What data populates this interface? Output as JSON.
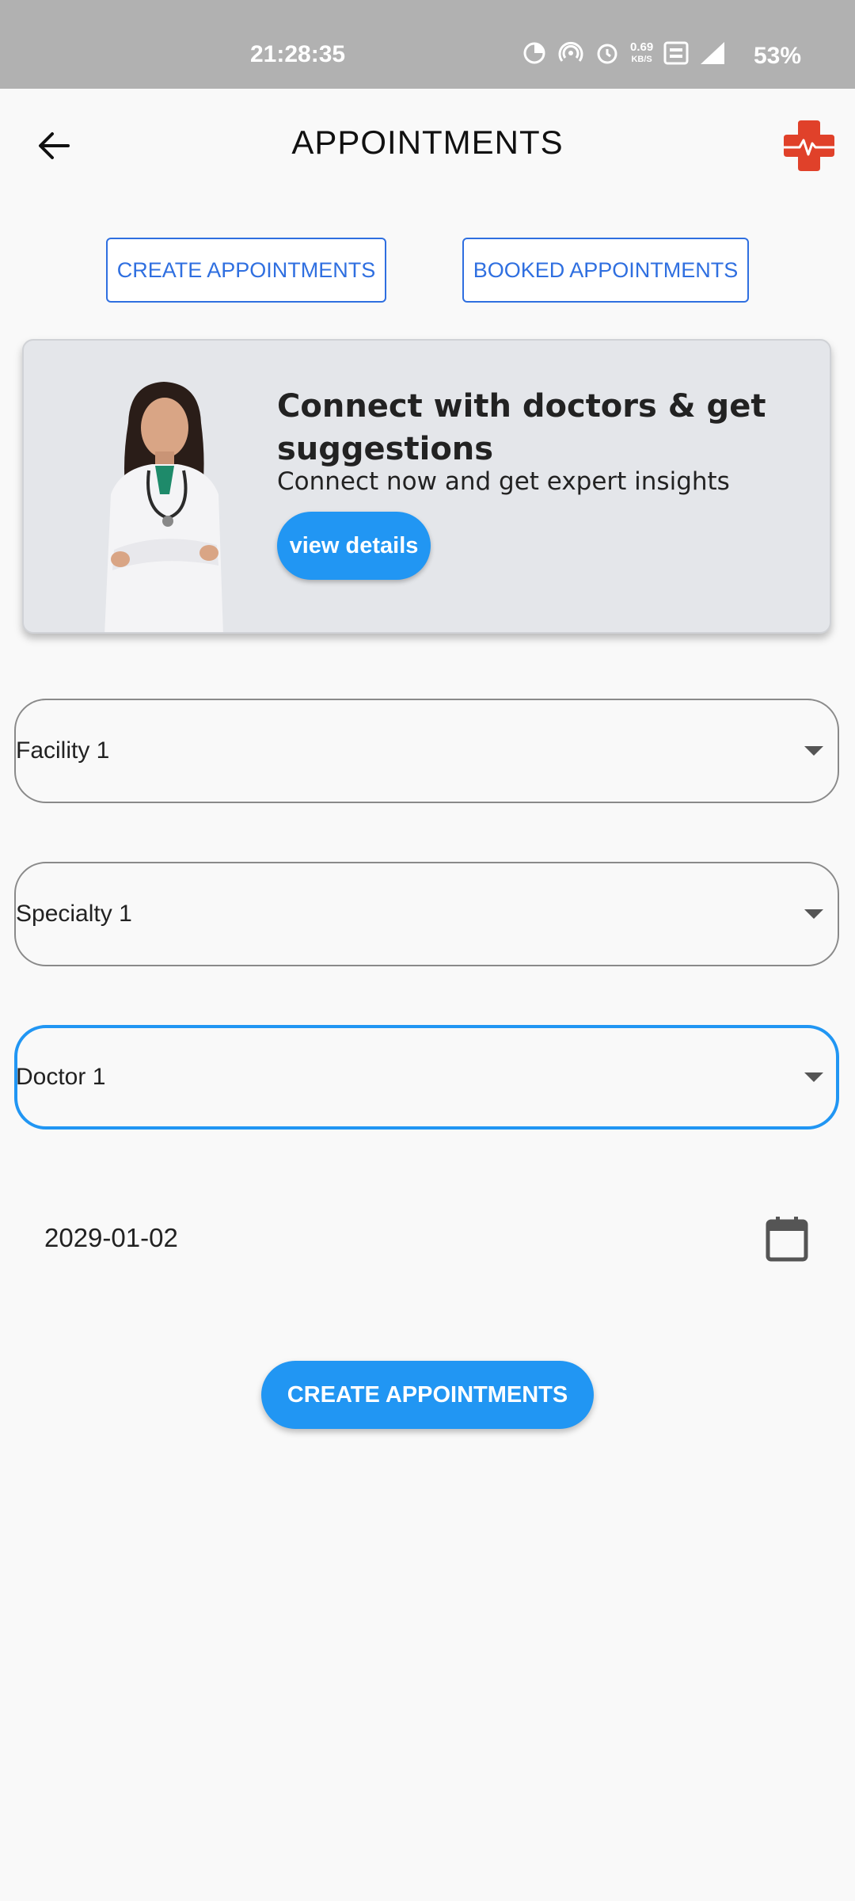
{
  "status_bar": {
    "time": "21:28:35",
    "speed_value": "0.69",
    "speed_unit": "KB/S",
    "battery": "53%"
  },
  "header": {
    "title": "APPOINTMENTS",
    "back_icon": "arrow-left-icon",
    "logo_icon": "medical-cross-heartbeat-logo"
  },
  "tabs": [
    {
      "label": "CREATE APPOINTMENTS"
    },
    {
      "label": "BOOKED APPOINTMENTS"
    }
  ],
  "banner": {
    "title": "Connect with doctors & get suggestions",
    "subtitle": "Connect now and get expert insights",
    "button_label": "view details"
  },
  "form": {
    "facility": "Facility 1",
    "specialty": "Specialty 1",
    "doctor": "Doctor 1",
    "date": "2029-01-02",
    "submit_label": "CREATE APPOINTMENTS"
  },
  "colors": {
    "accent": "#2196f3",
    "outline_blue": "#2f6fe0",
    "logo_red": "#e0412a"
  }
}
